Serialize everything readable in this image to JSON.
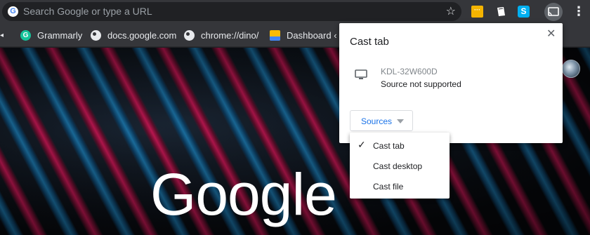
{
  "omnibox": {
    "placeholder": "Search Google or type a URL",
    "favicon_letter": "G"
  },
  "toolbar": {
    "icons": [
      "star-icon",
      "extension-yellow-icon",
      "extension-note-icon",
      "skype-icon",
      "cast-icon",
      "more-vert-icon"
    ],
    "skype_letter": "S",
    "ext_yellow_glyph": "···"
  },
  "bookmarks": {
    "items": [
      {
        "label": "Grammarly",
        "icon": "grammarly-icon",
        "icon_letter": "G"
      },
      {
        "label": "docs.google.com",
        "icon": "globe-icon"
      },
      {
        "label": "chrome://dino/",
        "icon": "globe-icon"
      },
      {
        "label": "Dashboard ‹ F",
        "icon": "suse-icon"
      }
    ]
  },
  "page": {
    "logo_text": "Google"
  },
  "cast_dialog": {
    "title": "Cast tab",
    "close_glyph": "✕",
    "device": {
      "name": "KDL-32W600D",
      "status": "Source not supported"
    },
    "sources_label": "Sources"
  },
  "sources_menu": {
    "selected_glyph": "✓",
    "options": [
      {
        "label": "Cast tab",
        "selected": true
      },
      {
        "label": "Cast desktop",
        "selected": false
      },
      {
        "label": "Cast file",
        "selected": false
      }
    ]
  },
  "colors": {
    "toolbar": "#35363a",
    "accent_blue": "#1a73e8",
    "cast_active": "#5f6368"
  }
}
